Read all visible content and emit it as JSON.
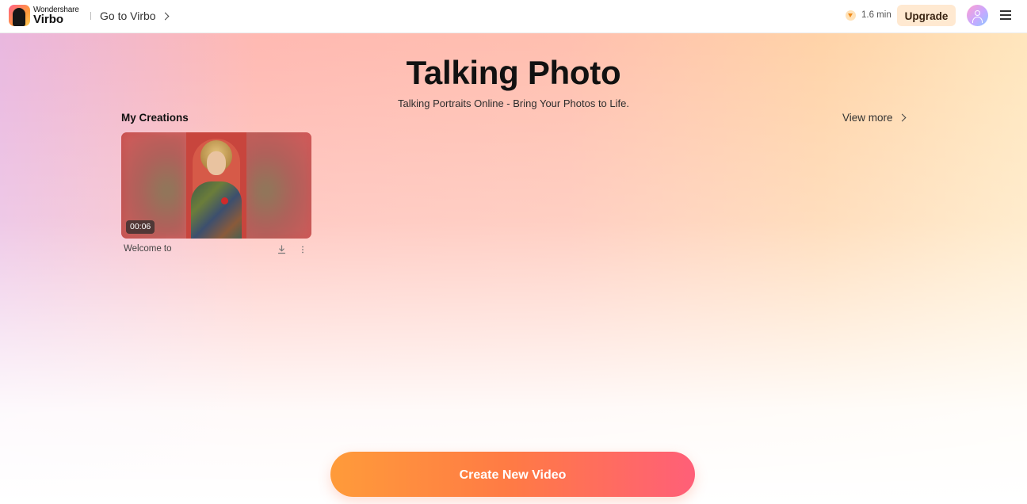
{
  "header": {
    "brand_small": "Wondershare",
    "brand_name": "Virbo",
    "goto_label": "Go to Virbo",
    "credits": "1.6 min",
    "upgrade_label": "Upgrade",
    "icons": [
      "virbo-logo-icon",
      "chevron-right-icon",
      "credit-icon",
      "user-avatar-icon",
      "hamburger-menu-icon"
    ]
  },
  "hero": {
    "title": "Talking Photo",
    "subtitle": "Talking Portraits Online - Bring Your Photos to Life."
  },
  "creations": {
    "section_title": "My Creations",
    "view_more_label": "View more",
    "items": [
      {
        "name": "Welcome to",
        "duration": "00:06",
        "icons": [
          "download-icon",
          "more-vertical-icon"
        ]
      }
    ]
  },
  "actions": {
    "create_label": "Create New Video"
  },
  "colors": {
    "accent_start": "#ff9b3a",
    "accent_end": "#ff5f78",
    "upgrade_bg": "#ffe9d1"
  }
}
